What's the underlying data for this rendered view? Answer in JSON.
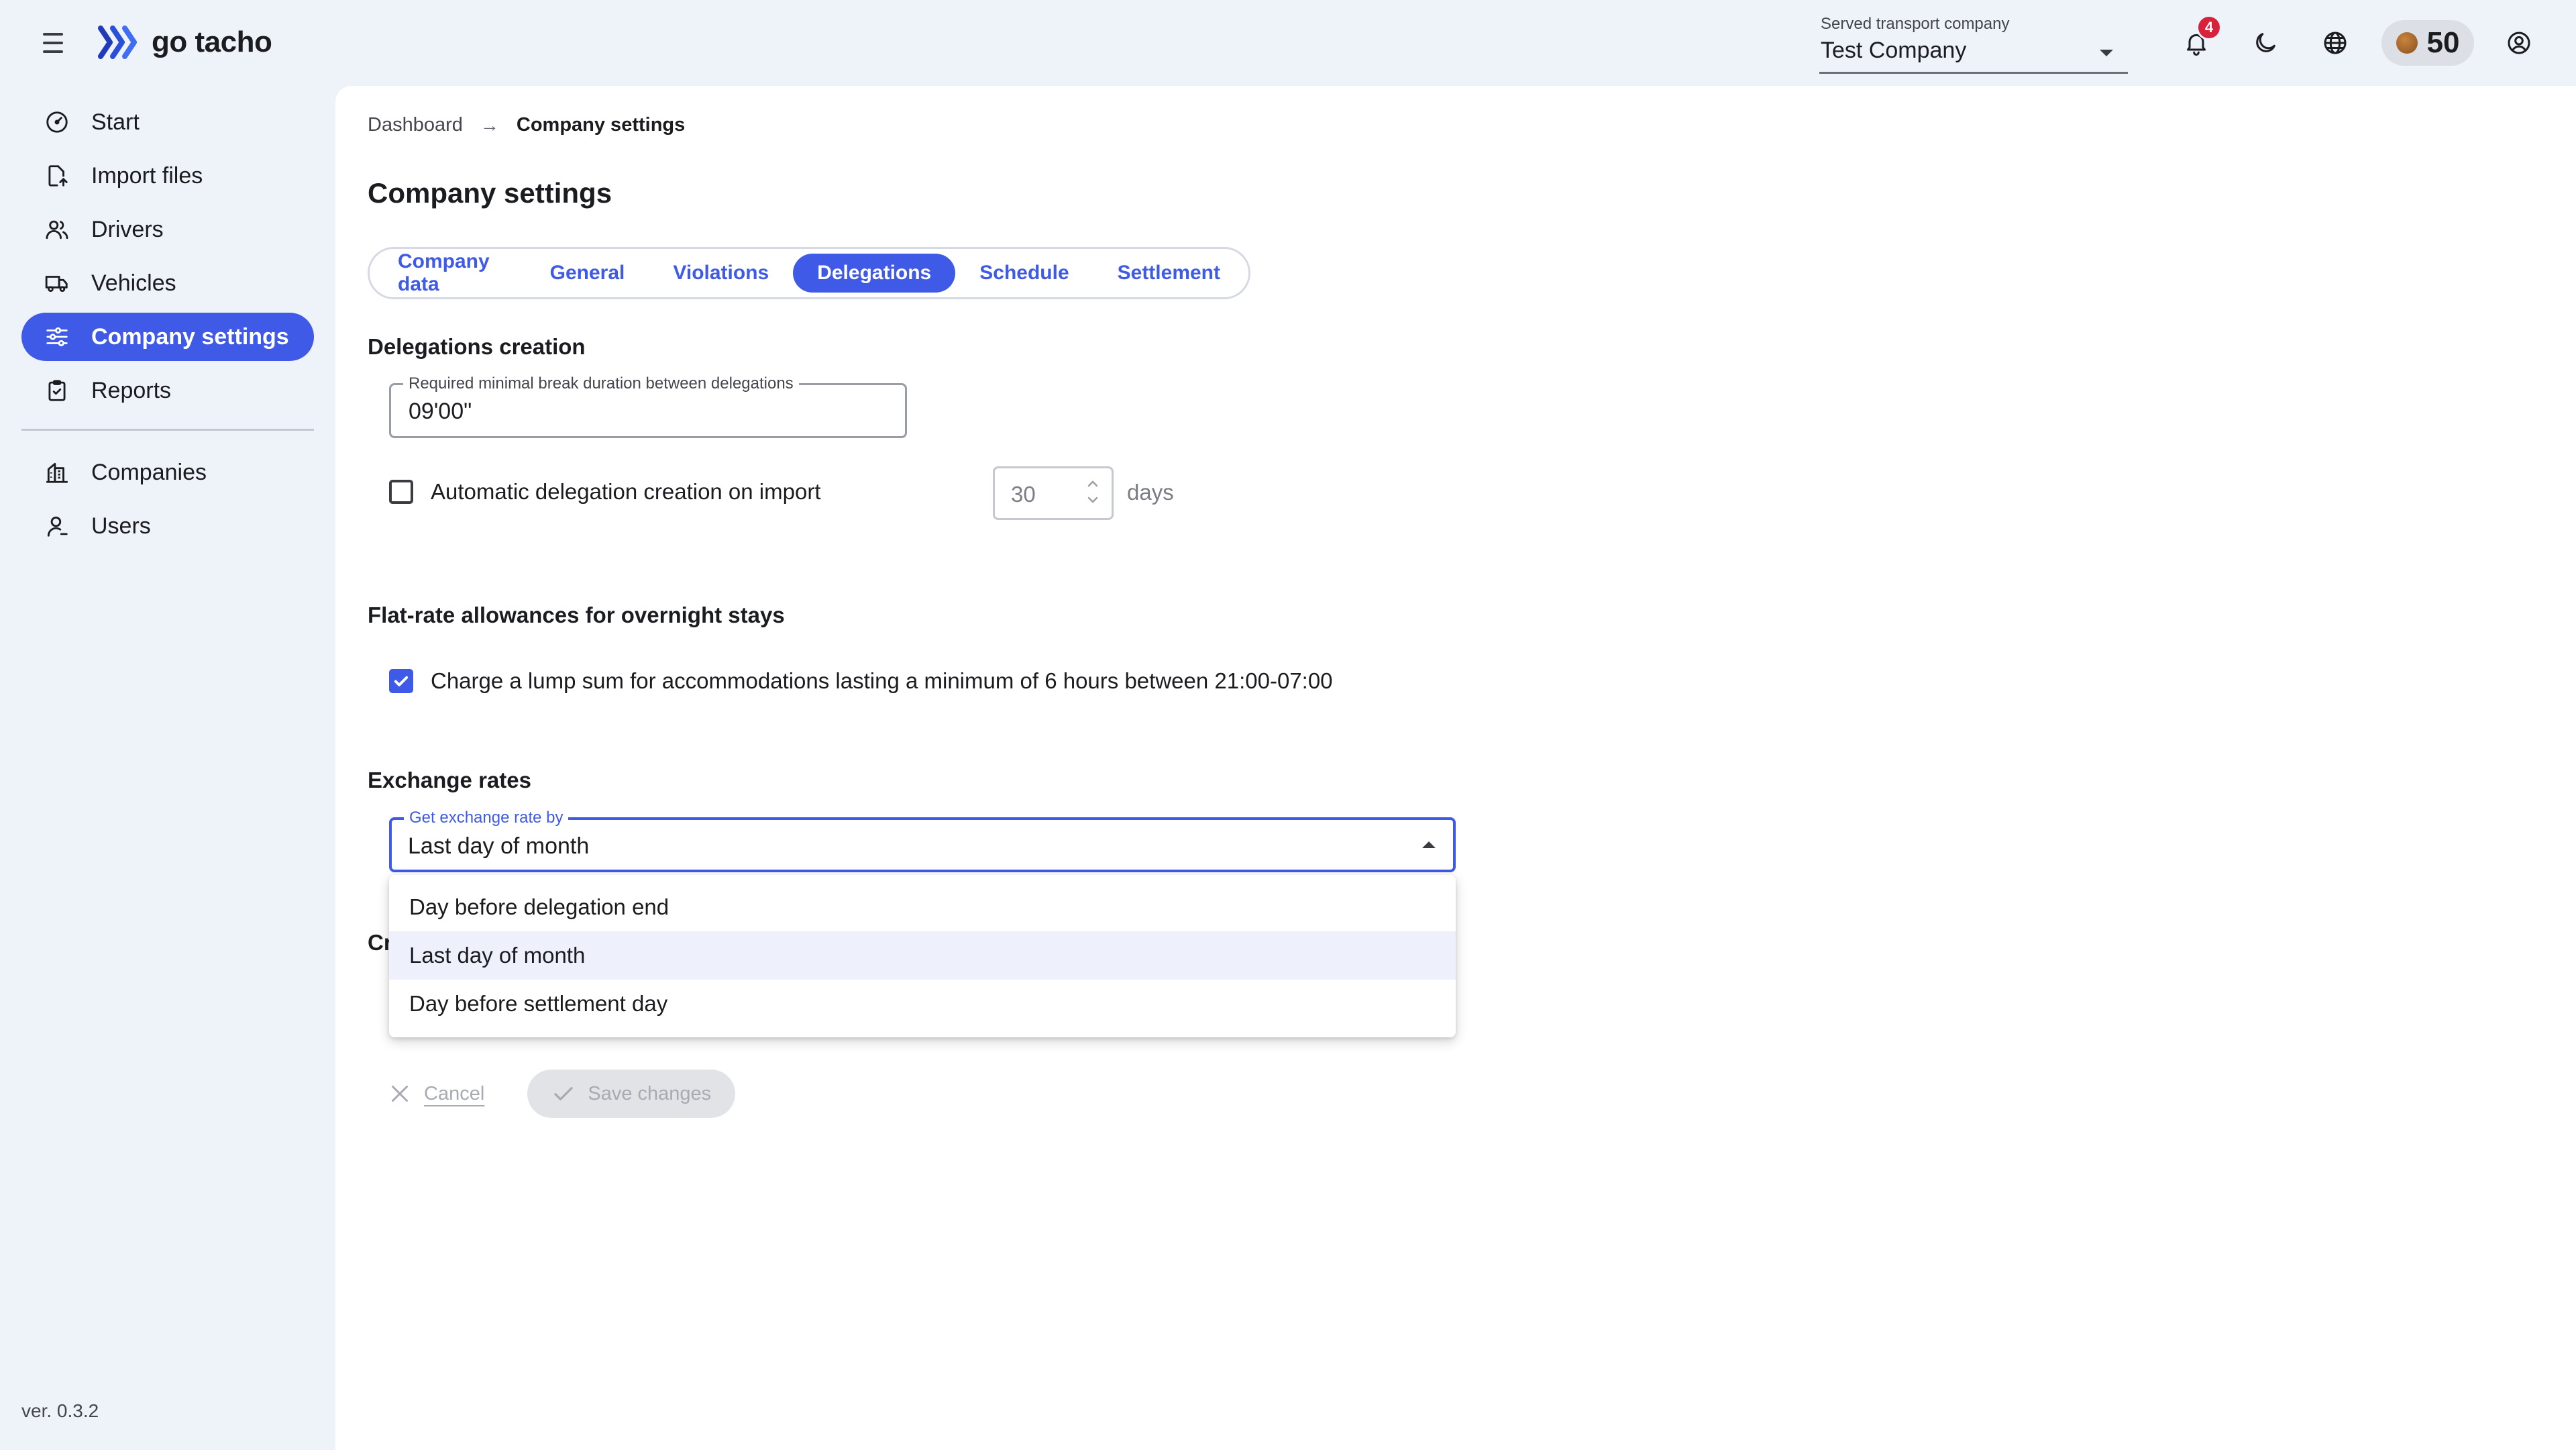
{
  "app": {
    "logo_text": "go tacho",
    "version": "ver. 0.3.2"
  },
  "header": {
    "company_select": {
      "caption": "Served transport company",
      "value": "Test Company"
    },
    "notifications_count": "4",
    "coins": "50"
  },
  "sidebar": {
    "items": [
      {
        "label": "Start",
        "icon": "gauge-icon"
      },
      {
        "label": "Import files",
        "icon": "file-import-icon"
      },
      {
        "label": "Drivers",
        "icon": "users-icon"
      },
      {
        "label": "Vehicles",
        "icon": "truck-icon"
      },
      {
        "label": "Company settings",
        "icon": "sliders-icon",
        "active": true
      },
      {
        "label": "Reports",
        "icon": "clipboard-icon"
      }
    ],
    "admin_items": [
      {
        "label": "Companies",
        "icon": "buildings-icon"
      },
      {
        "label": "Users",
        "icon": "user-icon"
      }
    ]
  },
  "breadcrumb": {
    "parent": "Dashboard",
    "current": "Company settings"
  },
  "page_title": "Company settings",
  "tabs": [
    {
      "label": "Company data"
    },
    {
      "label": "General"
    },
    {
      "label": "Violations"
    },
    {
      "label": "Delegations",
      "active": true
    },
    {
      "label": "Schedule"
    },
    {
      "label": "Settlement"
    }
  ],
  "delegations_creation": {
    "title": "Delegations creation",
    "break_field": {
      "label": "Required minimal break duration between delegations",
      "value": "09'00\""
    },
    "auto_creation": {
      "label": "Automatic delegation creation on import",
      "checked": false,
      "days_value": "30",
      "days_unit": "days"
    }
  },
  "flat_rate": {
    "title": "Flat-rate allowances for overnight stays",
    "lump_sum": {
      "label": "Charge a lump sum for accommodations lasting a minimum of 6 hours between 21:00-07:00",
      "checked": true
    }
  },
  "exchange_rates": {
    "title": "Exchange rates",
    "select": {
      "label": "Get exchange rate by",
      "value": "Last day of month",
      "options": [
        "Day before delegation end",
        "Last day of month",
        "Day before settlement day"
      ],
      "selected_index": 1
    }
  },
  "covered_section_title_fragment": "Cr",
  "actions": {
    "cancel_label": "Cancel",
    "save_label": "Save changes"
  },
  "colors": {
    "accent": "#3f5ae6",
    "badge": "#d9213b",
    "sidebar_bg": "#eef2f9"
  }
}
